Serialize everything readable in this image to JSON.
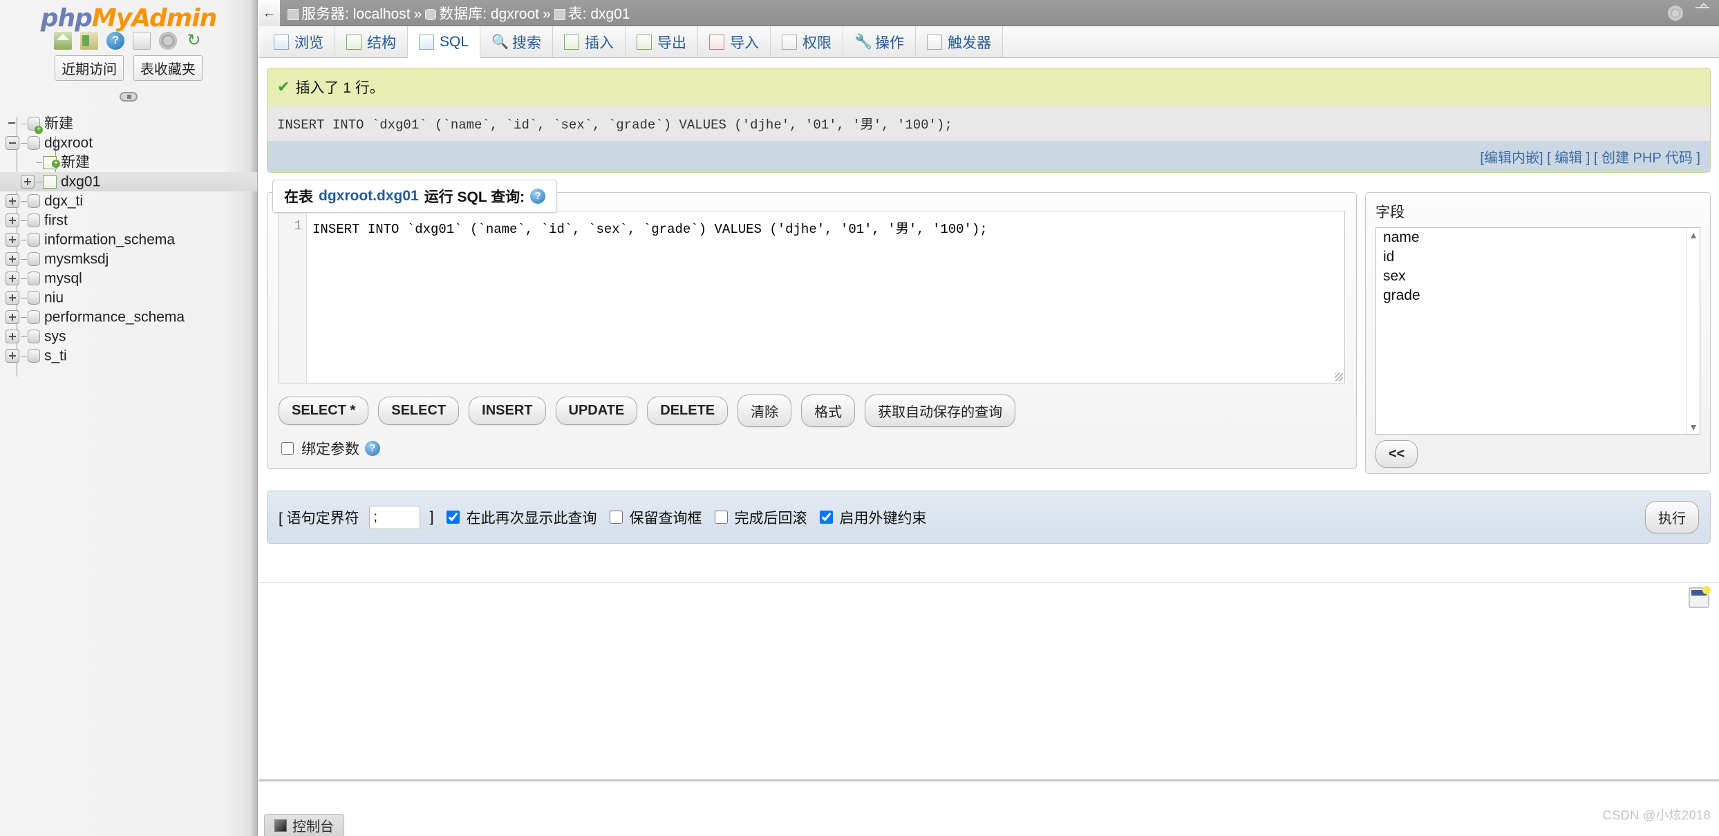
{
  "app": {
    "logo_php": "php",
    "logo_my": "My",
    "logo_admin": "Admin"
  },
  "nav_icons": [
    {
      "name": "home-icon",
      "label": "首页"
    },
    {
      "name": "exit-icon",
      "label": "退出"
    },
    {
      "name": "help-icon",
      "label": "?"
    },
    {
      "name": "docs-icon",
      "label": "文档"
    },
    {
      "name": "settings-icon",
      "label": "设置"
    },
    {
      "name": "reload-icon",
      "label": "↺"
    }
  ],
  "nav_quick": [
    {
      "label": "近期访问"
    },
    {
      "label": "表收藏夹"
    }
  ],
  "tree": [
    {
      "label": "新建",
      "level": 0,
      "ctl": "none",
      "icon": "new-db-icon",
      "selected": false
    },
    {
      "label": "dgxroot",
      "level": 0,
      "ctl": "minus",
      "icon": "db-icon",
      "selected": false
    },
    {
      "label": "新建",
      "level": 2,
      "ctl": "none",
      "icon": "new-table-icon",
      "selected": false
    },
    {
      "label": "dxg01",
      "level": 1,
      "ctl": "plus",
      "icon": "table-icon",
      "selected": true
    },
    {
      "label": "dgx_ti",
      "level": 0,
      "ctl": "plus",
      "icon": "db-icon",
      "selected": false
    },
    {
      "label": "first",
      "level": 0,
      "ctl": "plus",
      "icon": "db-icon",
      "selected": false
    },
    {
      "label": "information_schema",
      "level": 0,
      "ctl": "plus",
      "icon": "db-icon",
      "selected": false
    },
    {
      "label": "mysmksdj",
      "level": 0,
      "ctl": "plus",
      "icon": "db-icon",
      "selected": false
    },
    {
      "label": "mysql",
      "level": 0,
      "ctl": "plus",
      "icon": "db-icon",
      "selected": false
    },
    {
      "label": "niu",
      "level": 0,
      "ctl": "plus",
      "icon": "db-icon",
      "selected": false
    },
    {
      "label": "performance_schema",
      "level": 0,
      "ctl": "plus",
      "icon": "db-icon",
      "selected": false
    },
    {
      "label": "sys",
      "level": 0,
      "ctl": "plus",
      "icon": "db-icon",
      "selected": false
    },
    {
      "label": "s_ti",
      "level": 0,
      "ctl": "plus",
      "icon": "db-icon",
      "selected": false
    }
  ],
  "breadcrumb": {
    "back_label": "←",
    "server_label": "服务器: localhost",
    "db_label": "数据库: dgxroot",
    "table_label": "表: dxg01",
    "sep": "»"
  },
  "tabs": [
    {
      "label": "浏览",
      "icon": "browse-icon",
      "active": false
    },
    {
      "label": "结构",
      "icon": "structure-icon",
      "active": false
    },
    {
      "label": "SQL",
      "icon": "sql-icon",
      "active": true
    },
    {
      "label": "搜索",
      "icon": "search-icon",
      "active": false
    },
    {
      "label": "插入",
      "icon": "insert-icon",
      "active": false
    },
    {
      "label": "导出",
      "icon": "export-icon",
      "active": false
    },
    {
      "label": "导入",
      "icon": "import-icon",
      "active": false
    },
    {
      "label": "权限",
      "icon": "privileges-icon",
      "active": false
    },
    {
      "label": "操作",
      "icon": "operations-icon",
      "active": false
    },
    {
      "label": "触发器",
      "icon": "triggers-icon",
      "active": false
    }
  ],
  "result": {
    "message": "插入了 1 行。",
    "check_glyph": "✔",
    "sql_text": "INSERT INTO `dxg01` (`name`, `id`, `sex`, `grade`) VALUES ('djhe', '01', '男', '100');",
    "links": [
      {
        "label": "[编辑内嵌]"
      },
      {
        "label": "[ 编辑 ]"
      },
      {
        "label": "[ 创建 PHP 代码 ]"
      }
    ]
  },
  "query": {
    "title_prefix": "在表 ",
    "title_target": "dgxroot.dxg01",
    "title_suffix": " 运行 SQL 查询:",
    "help_glyph": "?",
    "line_number": "1",
    "editor_text": "INSERT INTO `dxg01` (`name`, `id`, `sex`, `grade`) VALUES ('djhe', '01', '男', '100');",
    "buttons": [
      {
        "label": "SELECT *",
        "name": "select-star-button"
      },
      {
        "label": "SELECT",
        "name": "select-button"
      },
      {
        "label": "INSERT",
        "name": "insert-button"
      },
      {
        "label": "UPDATE",
        "name": "update-button"
      },
      {
        "label": "DELETE",
        "name": "delete-button"
      },
      {
        "label": "清除",
        "name": "clear-button"
      },
      {
        "label": "格式",
        "name": "format-button"
      },
      {
        "label": "获取自动保存的查询",
        "name": "get-autosaved-query-button"
      }
    ],
    "bind_params_label": "绑定参数",
    "bind_params_checked": false
  },
  "columns_panel": {
    "label": "字段",
    "columns": [
      "name",
      "id",
      "sex",
      "grade"
    ],
    "collapse_label": "<<"
  },
  "options_bar": {
    "delimiter_open": "[ 语句定界符",
    "delimiter_value": ";",
    "delimiter_close": "]",
    "checkboxes": [
      {
        "label": "在此再次显示此查询",
        "checked": true,
        "name": "show-query-again-checkbox"
      },
      {
        "label": "保留查询框",
        "checked": false,
        "name": "keep-query-box-checkbox"
      },
      {
        "label": "完成后回滚",
        "checked": false,
        "name": "rollback-on-completion-checkbox"
      },
      {
        "label": "启用外键约束",
        "checked": true,
        "name": "enable-foreign-keys-checkbox"
      }
    ],
    "go_label": "执行"
  },
  "footer": {
    "console_label": "控制台",
    "watermark": "CSDN @小炫2018"
  },
  "colors": {
    "accent_blue": "#235a97",
    "logo_orange": "#f89406",
    "logo_blue": "#6c7eb7",
    "success_bg": "#e7eeb4",
    "success_check": "#3f9a2f",
    "options_bar_bg": "#d5dfea"
  }
}
